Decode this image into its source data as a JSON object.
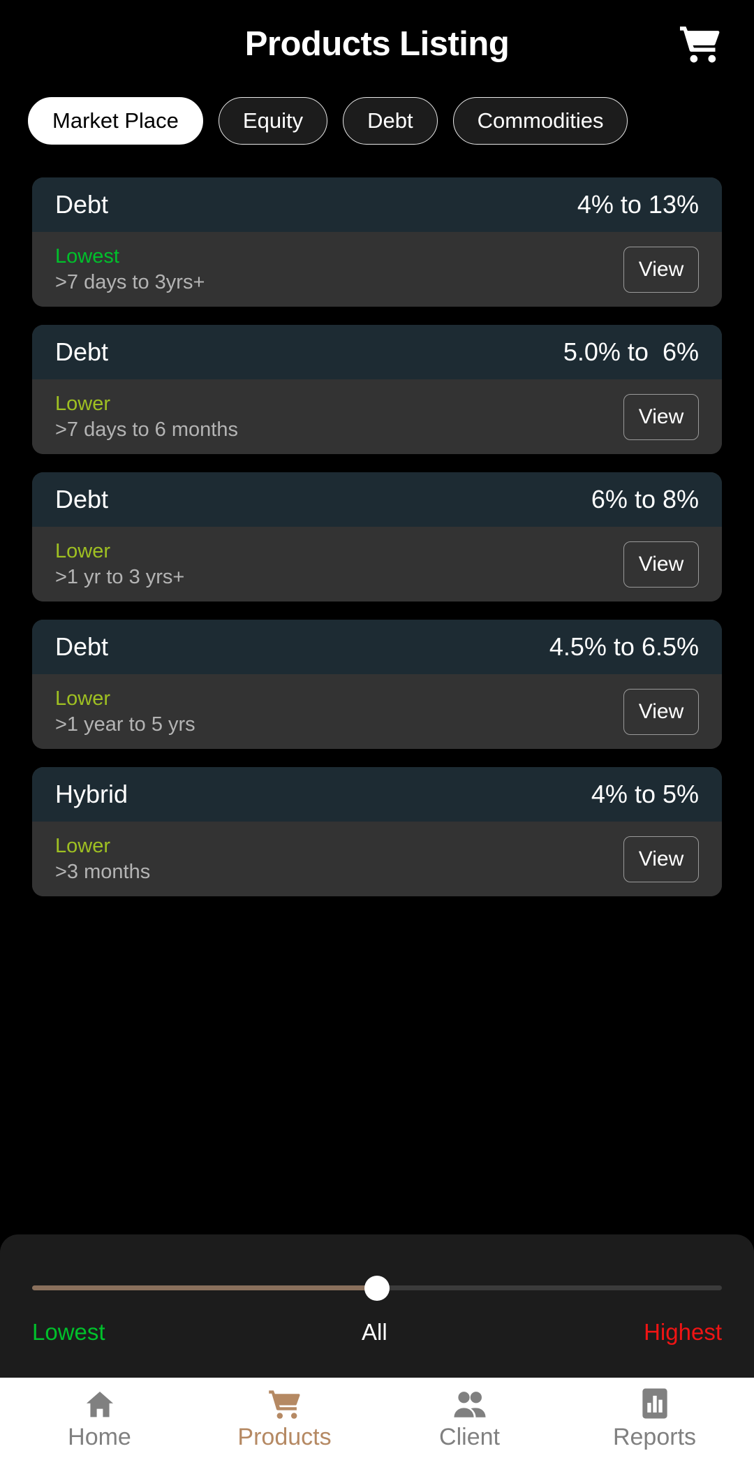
{
  "header": {
    "title": "Products Listing",
    "cart_icon": "shopping-cart-icon"
  },
  "tabs": [
    {
      "label": "Market Place",
      "active": true
    },
    {
      "label": "Equity",
      "active": false
    },
    {
      "label": "Debt",
      "active": false
    },
    {
      "label": "Commodities",
      "active": false
    }
  ],
  "products": [
    {
      "type": "Debt",
      "rate": "4% to 13%",
      "tier": "Lowest",
      "tier_color": "#00c02b",
      "duration": ">7 days to 3yrs+",
      "view_label": "View"
    },
    {
      "type": "Debt",
      "rate": "5.0% to  6%",
      "tier": "Lower",
      "tier_color": "#9fc022",
      "duration": ">7 days to 6 months",
      "view_label": "View"
    },
    {
      "type": "Debt",
      "rate": "6% to 8%",
      "tier": "Lower",
      "tier_color": "#9fc022",
      "duration": ">1 yr to 3 yrs+",
      "view_label": "View"
    },
    {
      "type": "Debt",
      "rate": "4.5% to 6.5%",
      "tier": "Lower",
      "tier_color": "#9fc022",
      "duration": ">1 year to 5 yrs",
      "view_label": "View"
    },
    {
      "type": "Hybrid",
      "rate": "4% to 5%",
      "tier": "Lower",
      "tier_color": "#9fc022",
      "duration": ">3 months",
      "view_label": "View"
    }
  ],
  "slider": {
    "left_label": "Lowest",
    "center_label": "All",
    "right_label": "Highest",
    "value_percent": 50,
    "fill_color": "#8a705c",
    "track_color": "#3b3b3b",
    "thumb_color": "#ffffff"
  },
  "bottom_nav": [
    {
      "label": "Home",
      "icon": "home-icon",
      "active": false
    },
    {
      "label": "Products",
      "icon": "shopping-cart-icon",
      "active": true
    },
    {
      "label": "Client",
      "icon": "people-icon",
      "active": false
    },
    {
      "label": "Reports",
      "icon": "bar-chart-icon",
      "active": false
    }
  ],
  "colors": {
    "background": "#000000",
    "card_header": "#1d2b33",
    "card_body": "#333333",
    "accent": "#b58963"
  }
}
